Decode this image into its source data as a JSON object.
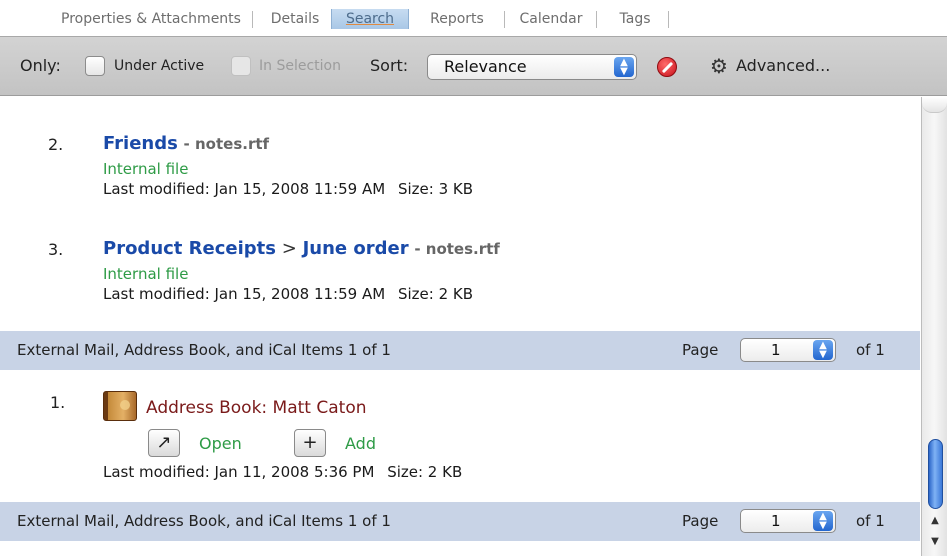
{
  "tabs": [
    {
      "label": "Properties & Attachments",
      "active": false
    },
    {
      "label": "Details",
      "active": false
    },
    {
      "label": "Search",
      "active": true
    },
    {
      "label": "Reports",
      "active": false
    },
    {
      "label": "Calendar",
      "active": false
    },
    {
      "label": "Tags",
      "active": false
    }
  ],
  "toolbar": {
    "only_label": "Only:",
    "under_active_label": "Under Active",
    "in_selection_label": "In Selection",
    "sort_label": "Sort:",
    "sort_value": "Relevance",
    "advanced_label": "Advanced..."
  },
  "results": [
    {
      "number": "2.",
      "title": "Friends",
      "file": "- notes.rtf",
      "location": "Internal file",
      "modified": "Last modified: Jan 15, 2008 11:59 AM",
      "size": "Size: 3 KB"
    },
    {
      "number": "3.",
      "title": "Product Receipts",
      "separator": ">",
      "subtitle": "June order",
      "file": "- notes.rtf",
      "location": "Internal file",
      "modified": "Last modified: Jan 15, 2008 11:59 AM",
      "size": "Size: 2 KB"
    }
  ],
  "external_section": {
    "title": "External Mail, Address Book, and iCal Items 1 of 1",
    "page_label": "Page",
    "page_value": "1",
    "of_label": "of 1"
  },
  "external_results": [
    {
      "number": "1.",
      "title": "Address Book: Matt Caton",
      "open_label": "Open",
      "add_label": "Add",
      "modified": "Last modified: Jan 11, 2008 5:36 PM",
      "size": "Size: 2 KB"
    }
  ],
  "colors": {
    "link": "#1a4aa8",
    "green": "#2e9b46",
    "section_bg": "#c8d3e6",
    "contact": "#7a1a1a"
  }
}
